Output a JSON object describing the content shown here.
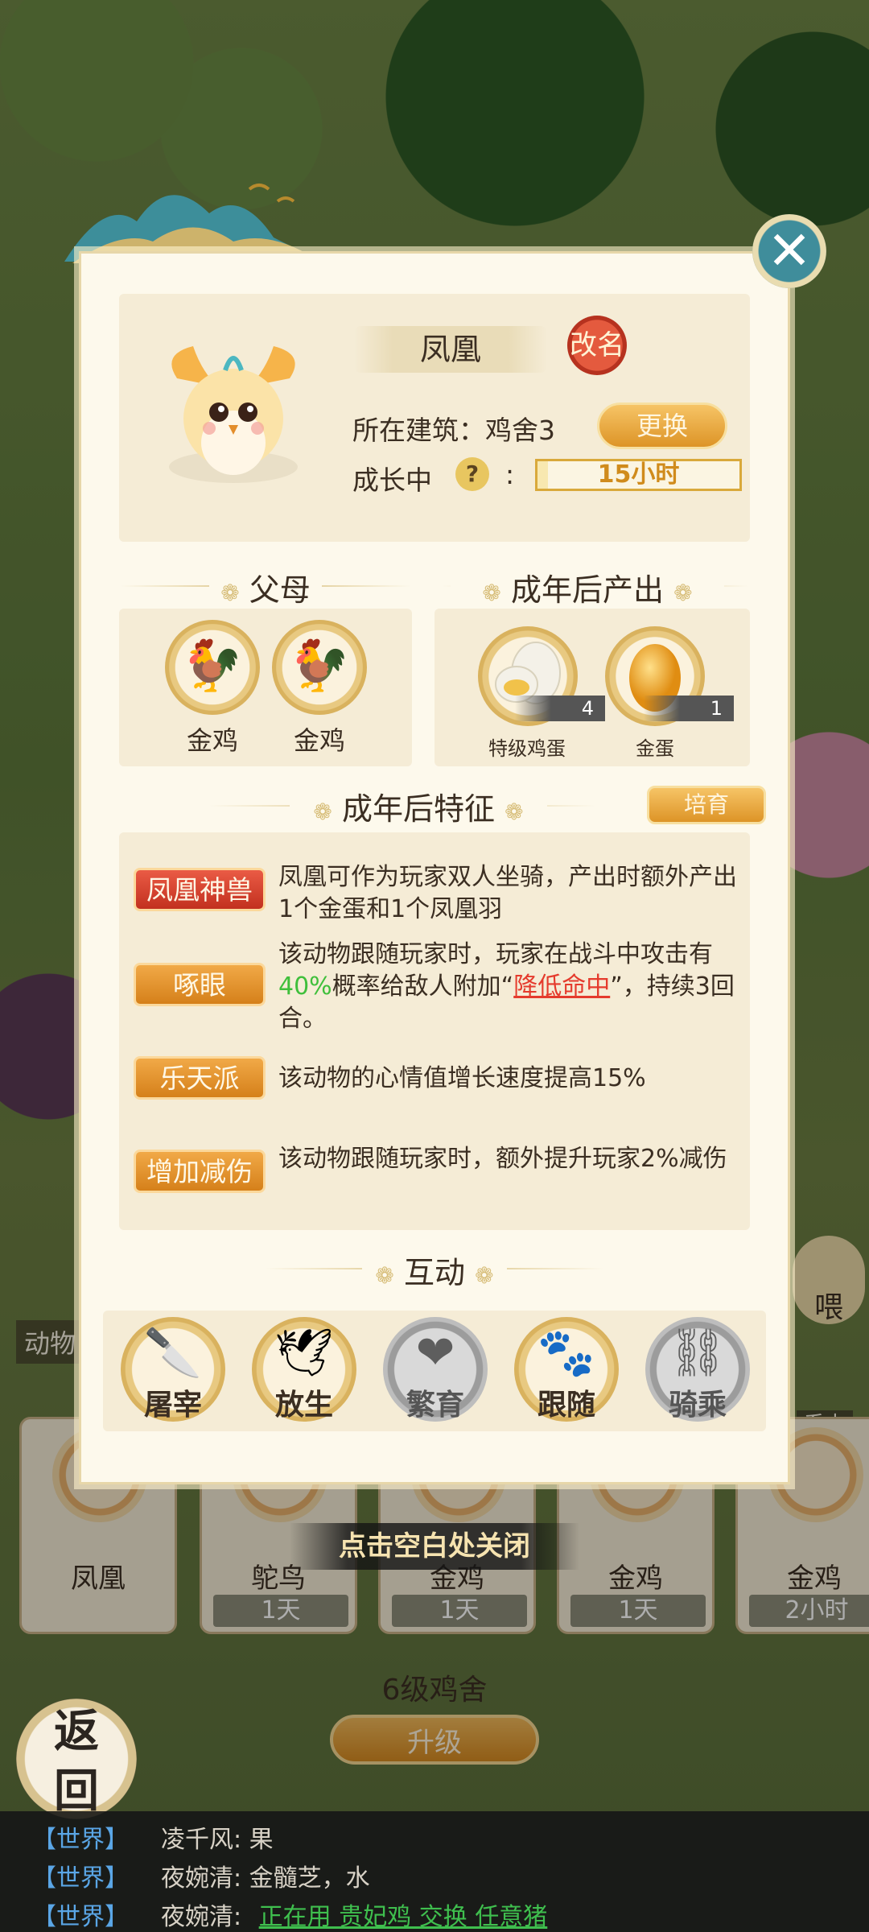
{
  "dialog": {
    "animal_name": "凤凰",
    "rename_label": "改名",
    "building_label": "所在建筑：鸡舍3",
    "change_label": "更换",
    "growth_label": "成长中",
    "help_glyph": "?",
    "colon": ":",
    "growth_time": "15小时",
    "growth_progress": 0.05,
    "close_glyph": "✕"
  },
  "parents": {
    "heading": "父母",
    "items": [
      {
        "name": "金鸡",
        "icon": "golden-chicken-icon"
      },
      {
        "name": "金鸡",
        "icon": "golden-chicken-icon"
      }
    ]
  },
  "adult_output": {
    "heading": "成年后产出",
    "items": [
      {
        "name": "特级鸡蛋",
        "count": "4",
        "icon": "premium-egg-icon"
      },
      {
        "name": "金蛋",
        "count": "1",
        "icon": "golden-egg-icon"
      }
    ]
  },
  "traits": {
    "heading": "成年后特征",
    "breed_label": "培育",
    "items": [
      {
        "tag": "凤凰神兽",
        "style": "red",
        "desc": "凤凰可作为玩家双人坐骑，产出时额外产出1个金蛋和1个凤凰羽"
      },
      {
        "tag": "啄眼",
        "style": "orange",
        "desc_pre": "该动物跟随玩家时，玩家在战斗中攻击有",
        "desc_pct": "40%",
        "desc_mid": "概率给敌人附加“",
        "desc_link": "降低命中",
        "desc_post": "”，持续3回合。"
      },
      {
        "tag": "乐天派",
        "style": "orange",
        "desc": "该动物的心情值增长速度提高15%"
      },
      {
        "tag": "增加减伤",
        "style": "orange",
        "desc": "该动物跟随玩家时，额外提升玩家2%减伤"
      }
    ]
  },
  "interaction": {
    "heading": "互动",
    "actions": [
      {
        "label": "屠宰",
        "icon": "cleaver-icon",
        "enabled": true
      },
      {
        "label": "放生",
        "icon": "bird-icon",
        "enabled": true
      },
      {
        "label": "繁育",
        "icon": "hearts-icon",
        "enabled": false
      },
      {
        "label": "跟随",
        "icon": "pawprint-icon",
        "enabled": true
      },
      {
        "label": "骑乘",
        "icon": "saddle-icon",
        "enabled": false
      }
    ]
  },
  "close_hint": "点击空白处关闭",
  "background": {
    "side_left_label": "动物",
    "side_right_label": "喂",
    "side_right_tag": "系中",
    "pets": [
      {
        "name": "凤凰",
        "time": ""
      },
      {
        "name": "鸵鸟",
        "time": "1天"
      },
      {
        "name": "金鸡",
        "time": "1天"
      },
      {
        "name": "金鸡",
        "time": "1天"
      },
      {
        "name": "金鸡",
        "time": "2小时"
      }
    ],
    "coop_title": "6级鸡舍",
    "upgrade_label": "升级",
    "back_label": "返回"
  },
  "chat": [
    {
      "channel": "【世界】",
      "text": "凌千风: 果"
    },
    {
      "channel": "【世界】",
      "text": "夜婉清: 金髓芝，水"
    },
    {
      "channel": "【世界】",
      "speaker": "夜婉清:",
      "link": "正在用 贵妃鸡 交换 任意猪"
    }
  ],
  "colors": {
    "accent_gold": "#dd9427",
    "rename_red": "#c2301f",
    "panel_bg": "#fdf9ec",
    "section_bg": "#f5ecd6",
    "chat_channel": "#5aa6e6",
    "link_green": "#3fbf4e"
  }
}
